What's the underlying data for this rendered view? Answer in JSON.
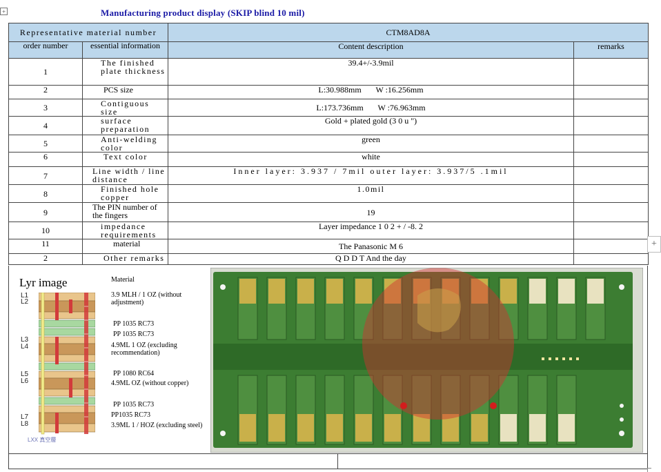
{
  "handle_icon": "move-cross-icon",
  "title": "Manufacturing product display (SKIP blind 10 mil)",
  "header": {
    "rep_label": "Representative material number",
    "rep_value": "CTM8AD8A",
    "col_order": "order number",
    "col_info": "essential information",
    "col_content": "Content description",
    "col_remarks": "remarks"
  },
  "rows": [
    {
      "order": "1",
      "info": "The finished plate thickness",
      "content": "39.4+/-3.9mil"
    },
    {
      "order": "2",
      "info": "PCS size",
      "content": "L:30.988mm       W :16.256mm"
    },
    {
      "order": "3",
      "info": "Contiguous size",
      "content": "L:173.736mm       W :76.963mm"
    },
    {
      "order": "4",
      "info": "surface preparation",
      "content": "Gold + plated gold (3 0 u \")"
    },
    {
      "order": "5",
      "info": "Anti-welding color",
      "content": "green"
    },
    {
      "order": "6",
      "info": "Text color",
      "content": "white"
    },
    {
      "order": "7",
      "info": "Line width / line distance",
      "content": "Inner layer: 3.937 / 7mil outer layer: 3.937/5 .1mil"
    },
    {
      "order": "8",
      "info": "Finished hole copper",
      "content": "1.0mil"
    },
    {
      "order": "9",
      "info": "The PIN number of the fingers",
      "content": "19"
    },
    {
      "order": "10",
      "info": "impedance requirements",
      "content": "Layer impedance 1 0 2 + / -8. 2"
    },
    {
      "order": "11",
      "info": "material",
      "content": "The Panasonic M 6"
    },
    {
      "order": "2",
      "info": "Other remarks",
      "content": "Q D D T And the day"
    }
  ],
  "layer_image": {
    "label": "Lyr image",
    "layer_names": [
      "L1",
      "L2",
      "L3",
      "L4",
      "L5",
      "L6",
      "L7",
      "L8"
    ],
    "material_heading": "Material",
    "materials": [
      "3.9 MLH / 1 OZ (without adjustment)",
      "PP  1035  RC73",
      "PP  1035 RC73",
      "4.9ML 1 OZ (excluding recommendation)",
      "PP  1080 RC64",
      "4.9ML OZ (without copper)",
      "PP  1035 RC73",
      "PP1035  RC73",
      "3.9ML 1 / HOZ (excluding steel)"
    ],
    "caption": "LXX 真空層"
  },
  "plus_icon": "plus-icon",
  "colors": {
    "header_bg": "#bcd7ec",
    "title_color": "#1a1aa6",
    "pcb_green": "#2f7a2f",
    "gold": "#c9b04a"
  }
}
